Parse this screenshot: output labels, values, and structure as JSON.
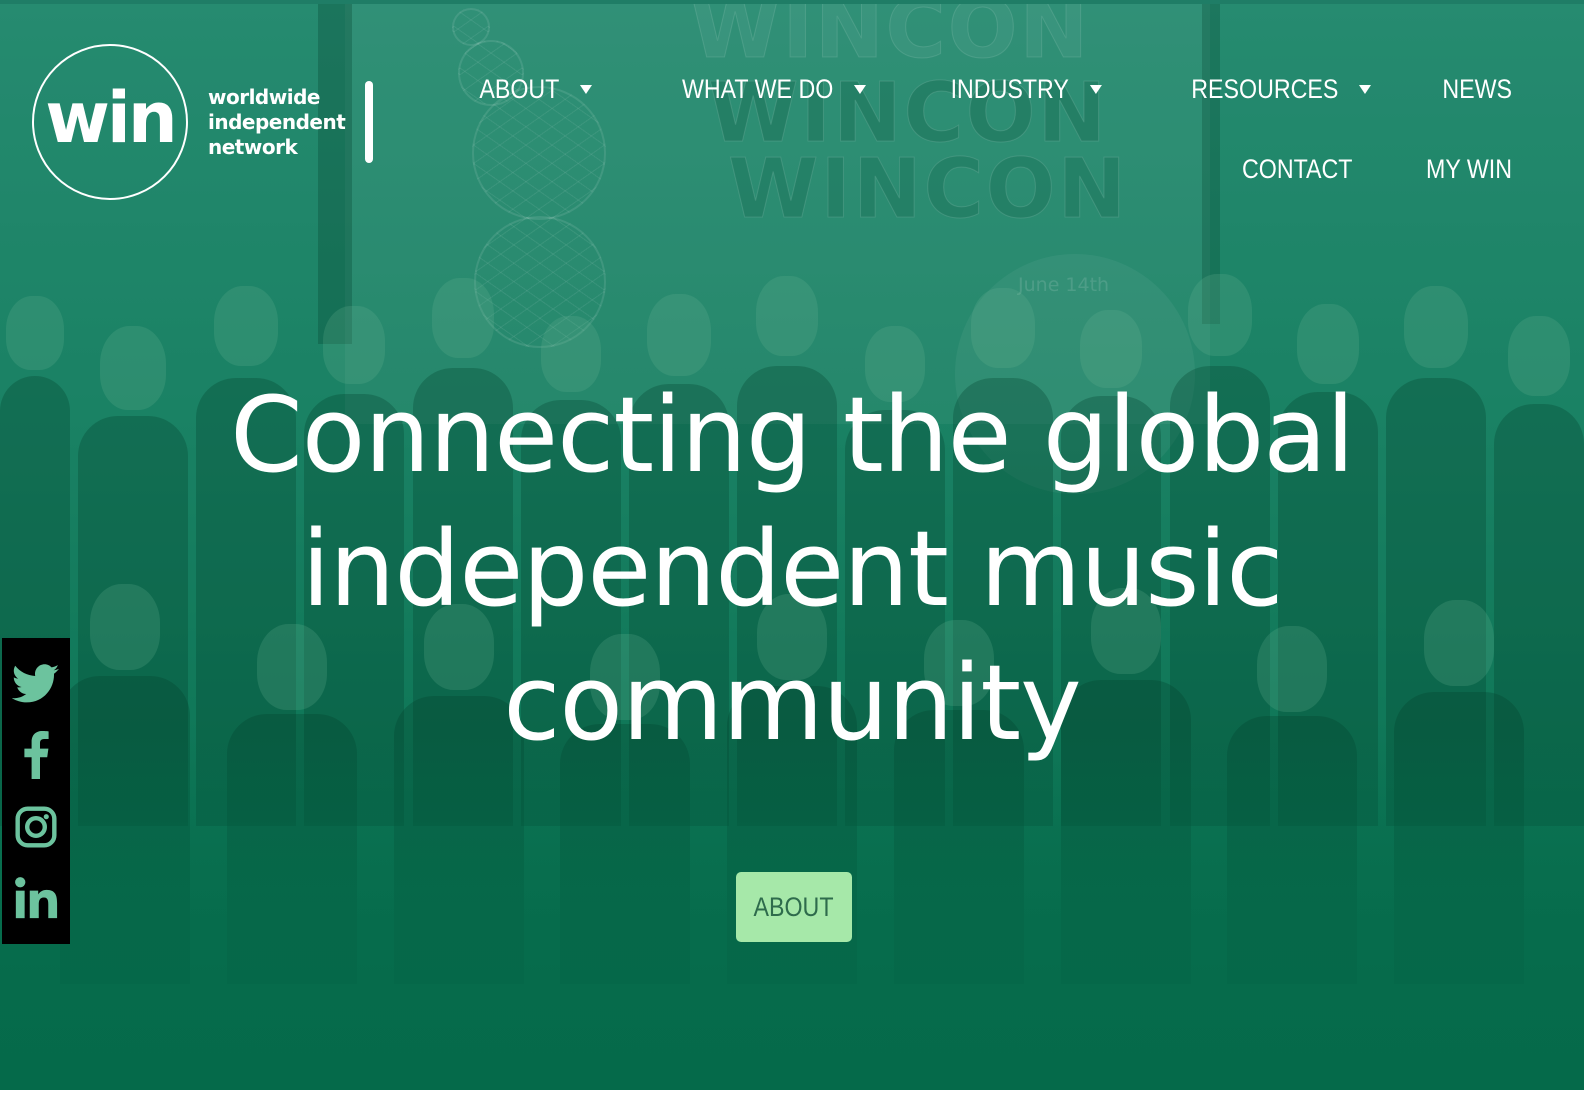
{
  "brand": {
    "logo_mark": "win",
    "tagline_lines": [
      "worldwide",
      "independent",
      "network"
    ]
  },
  "nav": {
    "row1": [
      {
        "label": "ABOUT",
        "has_dropdown": true
      },
      {
        "label": "WHAT WE DO",
        "has_dropdown": true
      },
      {
        "label": "INDUSTRY",
        "has_dropdown": true
      },
      {
        "label": "RESOURCES",
        "has_dropdown": true
      },
      {
        "label": "NEWS",
        "has_dropdown": false
      }
    ],
    "row2": [
      {
        "label": "CONTACT",
        "has_dropdown": false
      },
      {
        "label": "MY WIN",
        "has_dropdown": false
      }
    ]
  },
  "background": {
    "banner_lines": [
      "WINCON",
      "WINCON",
      "WINCON"
    ],
    "sign_text": "June 14th"
  },
  "hero": {
    "headline_lines": [
      "Connecting the global",
      "independent music",
      "community"
    ],
    "cta_label": "ABOUT"
  },
  "social": [
    {
      "name": "twitter-icon",
      "color": "#6cc39e"
    },
    {
      "name": "facebook-icon",
      "color": "#6cc39e"
    },
    {
      "name": "instagram-icon",
      "color": "#6cc39e"
    },
    {
      "name": "linkedin-icon",
      "color": "#6cc39e"
    }
  ],
  "colors": {
    "hero_green": "#0b7050",
    "cta_background": "#a6e8a9",
    "cta_text": "#2e6b4c",
    "social_bar": "#000000",
    "social_icon": "#6cc39e"
  }
}
